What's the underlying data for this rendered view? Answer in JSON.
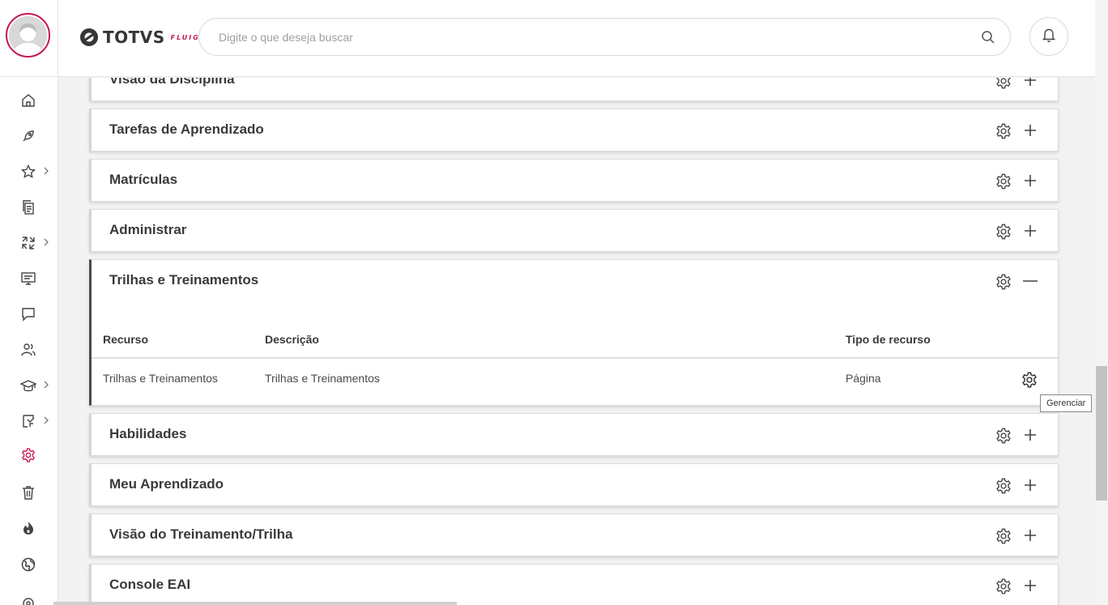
{
  "header": {
    "logo_text": "TOTVS",
    "logo_sub": "FLUIG",
    "search_placeholder": "Digite o que deseja buscar"
  },
  "sidebar": {
    "icons": [
      {
        "name": "home-icon"
      },
      {
        "name": "rocket-icon"
      },
      {
        "name": "star-icon",
        "has_submenu": true
      },
      {
        "name": "documents-icon"
      },
      {
        "name": "process-arrows-icon",
        "has_submenu": true
      },
      {
        "name": "presentation-icon"
      },
      {
        "name": "chat-icon"
      },
      {
        "name": "people-icon"
      },
      {
        "name": "graduation-cap-icon",
        "has_submenu": true
      },
      {
        "name": "task-icon",
        "has_submenu": true
      },
      {
        "name": "settings-icon",
        "active": true
      },
      {
        "name": "trash-icon"
      },
      {
        "name": "flame-icon"
      },
      {
        "name": "globe-icon"
      }
    ],
    "active_color": "#c8174d"
  },
  "panels": [
    {
      "title": "Visão da Disciplina",
      "expanded": false
    },
    {
      "title": "Tarefas de Aprendizado",
      "expanded": false
    },
    {
      "title": "Matrículas",
      "expanded": false
    },
    {
      "title": "Administrar",
      "expanded": false
    },
    {
      "title": "Trilhas e Treinamentos",
      "expanded": true
    },
    {
      "title": "Habilidades",
      "expanded": false
    },
    {
      "title": "Meu Aprendizado",
      "expanded": false
    },
    {
      "title": "Visão do Treinamento/Trilha",
      "expanded": false
    },
    {
      "title": "Console EAI",
      "expanded": false
    }
  ],
  "table": {
    "columns": [
      "Recurso",
      "Descrição",
      "Tipo de recurso"
    ],
    "rows": [
      {
        "recurso": "Trilhas e Treinamentos",
        "descricao": "Trilhas e Treinamentos",
        "tipo": "Página"
      }
    ]
  },
  "tooltip": "Gerenciar",
  "colors": {
    "brand": "#c8174d",
    "text": "#3a3a3a"
  }
}
